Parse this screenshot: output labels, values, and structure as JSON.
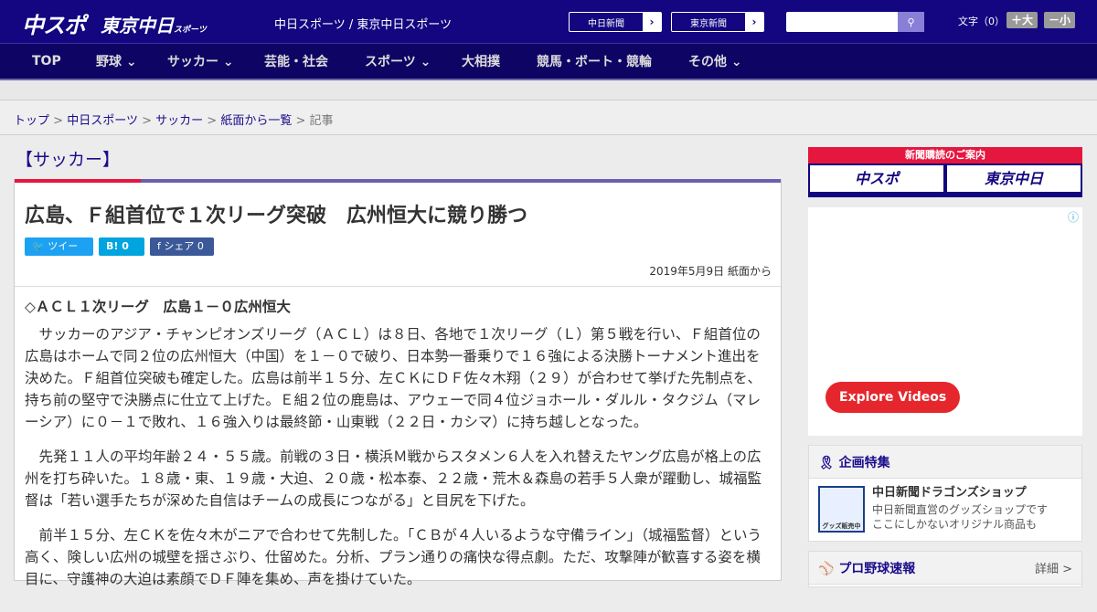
{
  "header": {
    "logo_chuspo": "中スポ",
    "logo_tokyo": "東京中日",
    "logo_tokyo_sub": "スポーツ",
    "site_name": "中日スポーツ / 東京中日スポーツ",
    "link1": "中日新聞",
    "link2": "東京新聞",
    "font_label": "文字（0）",
    "font_up": "＋大",
    "font_down": "－小"
  },
  "nav": [
    "TOP",
    "野球",
    "サッカー",
    "芸能・社会",
    "スポーツ",
    "大相撲",
    "競馬・ボート・競輪",
    "その他"
  ],
  "breadcrumb": {
    "items": [
      "トップ",
      "中日スポーツ",
      "サッカー",
      "紙面から一覧"
    ],
    "current": "記事",
    "sep": ">"
  },
  "article": {
    "category": "【サッカー】",
    "title": "広島、Ｆ組首位で１次リーグ突破　広州恒大に競り勝つ",
    "tweet": "ツイート",
    "hatena": "B! 0",
    "share": "シェア 0",
    "date": "2019年5月9日 紙面から",
    "subhead": "◇ＡＣＬ１次リーグ　広島１－０広州恒大",
    "paragraphs": [
      "サッカーのアジア・チャンピオンズリーグ（ＡＣＬ）は８日、各地で１次リーグ（Ｌ）第５戦を行い、Ｆ組首位の広島はホームで同２位の広州恒大（中国）を１－０で破り、日本勢一番乗りで１６強による決勝トーナメント進出を決めた。Ｆ組首位突破も確定した。広島は前半１５分、左ＣＫにＤＦ佐々木翔（２９）が合わせて挙げた先制点を、持ち前の堅守で決勝点に仕立て上げた。Ｅ組２位の鹿島は、アウェーで同４位ジョホール・ダルル・タクジム（マレーシア）に０－１で敗れ、１６強入りは最終節・山東戦（２２日・カシマ）に持ち越しとなった。",
      "先発１１人の平均年齢２４・５５歳。前戦の３日・横浜Ｍ戦からスタメン６人を入れ替えたヤング広島が格上の広州を打ち砕いた。１８歳・東、１９歳・大迫、２０歳・松本泰、２２歳・荒木＆森島の若手５人衆が躍動し、城福監督は「若い選手たちが深めた自信はチームの成長につながる」と目尻を下げた。",
      "前半１５分、左ＣＫを佐々木がニアで合わせて先制した。「ＣＢが４人いるような守備ライン」（城福監督）という高く、険しい広州の城壁を揺さぶり、仕留めた。分析、プラン通りの痛快な得点劇。ただ、攻撃陣が歓喜する姿を横目に、守護神の大迫は素顔でＤＦ陣を集め、声を掛けていた。"
    ]
  },
  "sidebar": {
    "subscribe_title": "新聞購読のご案内",
    "sub_logo1": "中スポ",
    "sub_logo2": "東京中日",
    "ad_button": "Explore Videos",
    "feature_title": "企画特集",
    "feature_item_title": "中日新聞ドラゴンズショップ",
    "feature_item_desc1": "中日新聞直営のグッズショップです",
    "feature_item_desc2": "ここにしかないオリジナル商品も",
    "feature_thumb_text": "グッズ販売中",
    "baseball_title": "プロ野球速報",
    "baseball_more": "詳細 >"
  },
  "colors": {
    "header": "#130680",
    "nav": "#0e0463",
    "accent_red": "#e5173f",
    "link": "#1a0c8a"
  }
}
